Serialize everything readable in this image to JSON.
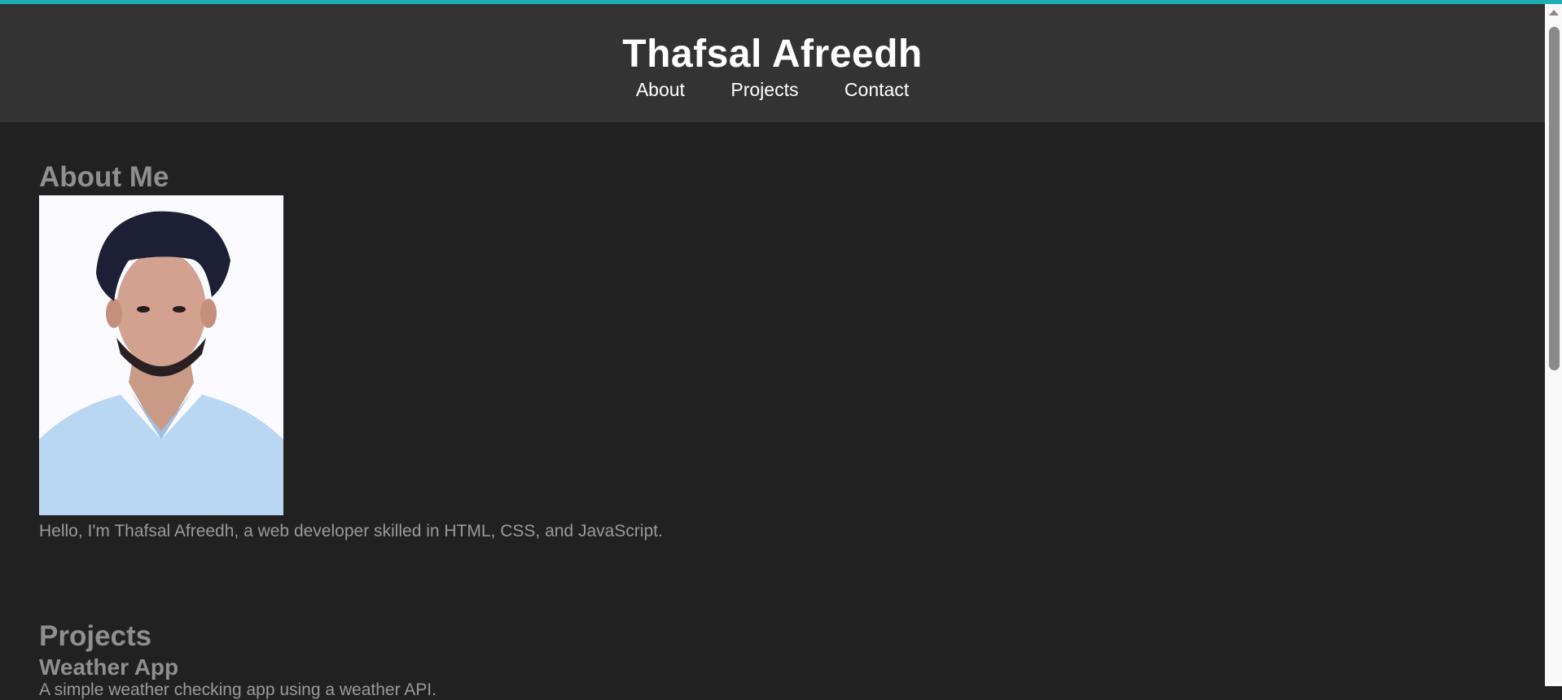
{
  "header": {
    "title": "Thafsal Afreedh",
    "nav": [
      "About",
      "Projects",
      "Contact"
    ]
  },
  "about": {
    "heading": "About Me",
    "bio": "Hello, I'm Thafsal Afreedh, a web developer skilled in HTML, CSS, and JavaScript."
  },
  "projects": {
    "heading": "Projects",
    "items": [
      {
        "title": "Weather App",
        "description": "A simple weather checking app using a weather API."
      }
    ]
  },
  "colors": {
    "accent": "#20adb3",
    "header_bg": "#333333",
    "page_bg": "#222122",
    "text": "#8f8f8f"
  }
}
